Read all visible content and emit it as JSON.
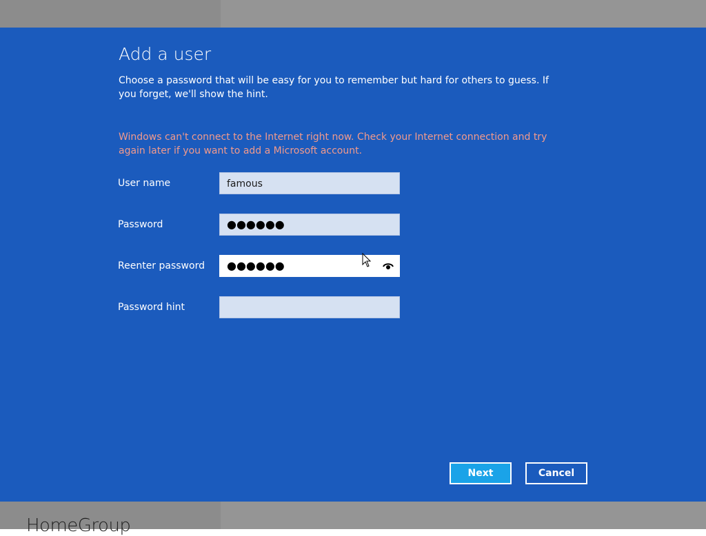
{
  "background": {
    "section_title": "HomeGroup"
  },
  "dialog": {
    "title": "Add a user",
    "instructions": "Choose a password that will be easy for you to remember but hard for others to guess. If you forget, we'll show the hint.",
    "warning": "Windows can't connect to the Internet right now. Check your Internet connection and try again later if you want to add a Microsoft account.",
    "fields": {
      "username": {
        "label": "User name",
        "value": "famous"
      },
      "password": {
        "label": "Password",
        "masked_value": "●●●●●●"
      },
      "reenter_password": {
        "label": "Reenter password",
        "masked_value": "●●●●●●",
        "icon": "reveal-password-eye-icon"
      },
      "password_hint": {
        "label": "Password hint",
        "value": ""
      }
    },
    "buttons": {
      "next": "Next",
      "cancel": "Cancel"
    }
  },
  "colors": {
    "dialog_background": "#1b5bbd",
    "warning_text": "#f29a8c",
    "next_button": "#1aa3e8"
  }
}
